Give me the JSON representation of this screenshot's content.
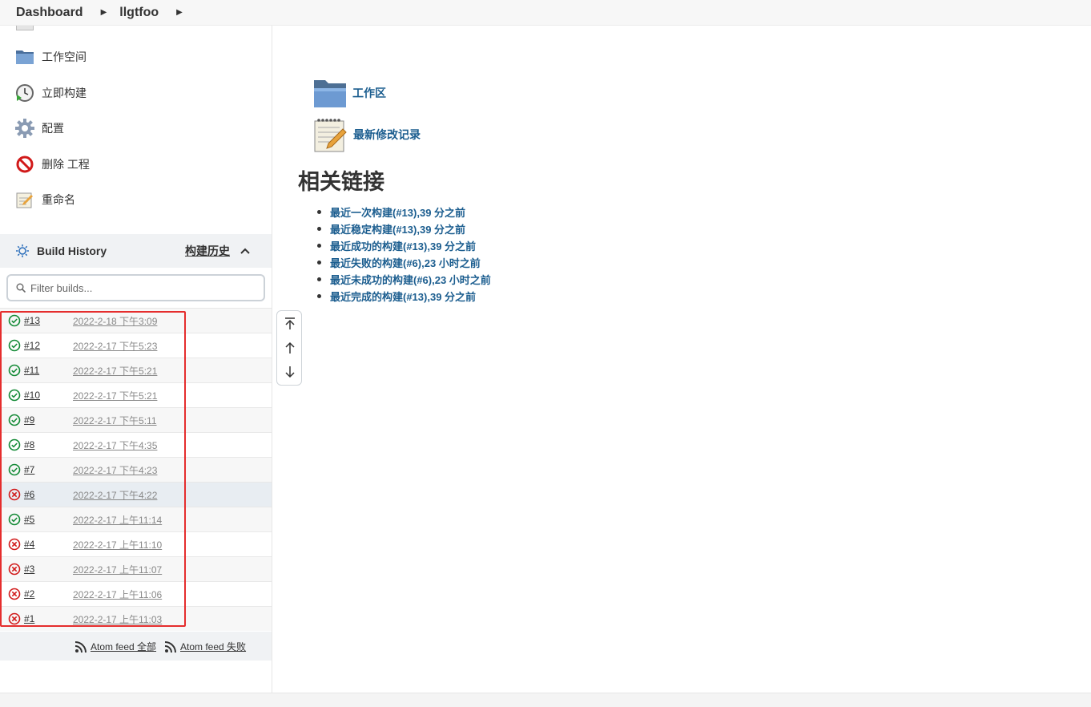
{
  "breadcrumb": {
    "dashboard": "Dashboard",
    "project": "llgtfoo"
  },
  "sidebar": {
    "items": [
      {
        "label": "工作空间",
        "icon": "folder-icon"
      },
      {
        "label": "立即构建",
        "icon": "build-now-icon"
      },
      {
        "label": "配置",
        "icon": "gear-icon"
      },
      {
        "label": "删除 工程",
        "icon": "delete-icon"
      },
      {
        "label": "重命名",
        "icon": "rename-icon"
      }
    ]
  },
  "build_history": {
    "title": "Build History",
    "trend_label": "构建历史",
    "filter_placeholder": "Filter builds...",
    "builds": [
      {
        "num": "#13",
        "date": "2022-2-18 下午3:09",
        "status": "success"
      },
      {
        "num": "#12",
        "date": "2022-2-17 下午5:23",
        "status": "success"
      },
      {
        "num": "#11",
        "date": "2022-2-17 下午5:21",
        "status": "success"
      },
      {
        "num": "#10",
        "date": "2022-2-17 下午5:21",
        "status": "success"
      },
      {
        "num": "#9",
        "date": "2022-2-17 下午5:11",
        "status": "success"
      },
      {
        "num": "#8",
        "date": "2022-2-17 下午4:35",
        "status": "success"
      },
      {
        "num": "#7",
        "date": "2022-2-17 下午4:23",
        "status": "success"
      },
      {
        "num": "#6",
        "date": "2022-2-17 下午4:22",
        "status": "failed"
      },
      {
        "num": "#5",
        "date": "2022-2-17 上午11:14",
        "status": "success"
      },
      {
        "num": "#4",
        "date": "2022-2-17 上午11:10",
        "status": "failed"
      },
      {
        "num": "#3",
        "date": "2022-2-17 上午11:07",
        "status": "failed"
      },
      {
        "num": "#2",
        "date": "2022-2-17 上午11:06",
        "status": "failed"
      },
      {
        "num": "#1",
        "date": "2022-2-17 上午11:03",
        "status": "failed"
      }
    ],
    "feed_all": "Atom feed 全部",
    "feed_failed": "Atom feed 失败"
  },
  "main": {
    "workspace_link": "工作区",
    "changes_link": "最新修改记录",
    "related_title": "相关链接",
    "related_links": [
      "最近一次构建(#13),39 分之前",
      "最近稳定构建(#13),39 分之前",
      "最近成功的构建(#13),39 分之前",
      "最近失败的构建(#6),23 小时之前",
      "最近未成功的构建(#6),23 小时之前",
      "最近完成的构建(#13),39 分之前"
    ]
  },
  "colors": {
    "success": "#138a36",
    "failed": "#d11a1a",
    "link": "#1b5d8f",
    "highlight_box": "#e52d2d"
  }
}
